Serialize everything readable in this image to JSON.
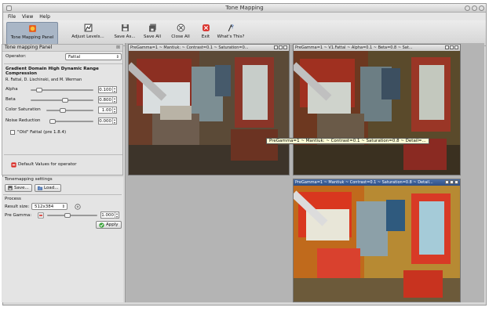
{
  "window": {
    "title": "Tone Mapping"
  },
  "menu": [
    "File",
    "View",
    "Help"
  ],
  "toolbar": [
    {
      "label": "Tone Mapping Panel",
      "icon": "tone-mapping-panel-icon"
    },
    {
      "label": "Adjust Levels...",
      "icon": "adjust-levels-icon"
    },
    {
      "label": "Save As...",
      "icon": "save-as-icon"
    },
    {
      "label": "Save All",
      "icon": "save-all-icon"
    },
    {
      "label": "Close All",
      "icon": "close-all-icon"
    },
    {
      "label": "Exit",
      "icon": "exit-icon"
    },
    {
      "label": "What's This?",
      "icon": "whats-this-icon"
    }
  ],
  "panel": {
    "title": "Tone mapping Panel",
    "operator_label": "Operator:",
    "operator_value": "Fattal",
    "method_title": "Gradient Domain High Dynamic Range Compression",
    "method_authors": "R. Fattal, D. Lischinski, and M. Werman",
    "params": [
      {
        "label": "Alpha",
        "value": "0.100",
        "level": 0.1
      },
      {
        "label": "Beta",
        "value": "0.800",
        "level": 0.55
      },
      {
        "label": "Color Saturation",
        "value": "1.00",
        "level": 0.33
      },
      {
        "label": "Noise Reduction",
        "value": "0.000",
        "level": 0.0
      }
    ],
    "old_fattal_label": "\"Old\" Fattal (pre 1.8.4)",
    "default_button": "Default Values for operator"
  },
  "settings": {
    "title": "Tonemapping settings",
    "save": "Save...",
    "load": "Load..."
  },
  "process": {
    "title": "Process",
    "result_size_label": "Result size:",
    "result_size_value": "512x384",
    "pregamma_label": "Pre Gamma:",
    "pregamma_value": "1.000",
    "apply": "Apply"
  },
  "subwindows": [
    {
      "title": "PreGamma=1 ~ Mantiuk: ~ Contrast=0.1 ~ Saturation=0..."
    },
    {
      "title": "PreGamma=1 ~ V1.Fattal ~ Alpha=0.1 ~ Beta=0.8 ~ Sat..."
    },
    {
      "title": "PreGamma=1 ~ Mantiuk ~ Contrast=0.1 ~ Saturation=0.8 ~ Detail..."
    }
  ],
  "tooltip": "PreGamma=1 ~ Mantiuk: ~ Contrast=0.1 ~ Saturation=0.8 ~ Detail=..."
}
